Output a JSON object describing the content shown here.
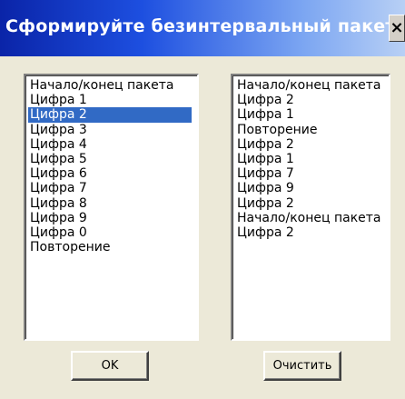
{
  "window": {
    "title": "Сформируйте безинтервальный пакет ...",
    "close_label": "×"
  },
  "left_list": {
    "items": [
      "Начало/конец пакета",
      "Цифра 1",
      "Цифра 2",
      "Цифра 3",
      "Цифра 4",
      "Цифра 5",
      "Цифра 6",
      "Цифра 7",
      "Цифра 8",
      "Цифра 9",
      "Цифра 0",
      "Повторение"
    ],
    "selected": "Цифра 2"
  },
  "right_list": {
    "items": [
      "Начало/конец пакета",
      "Цифра 2",
      "Цифра 1",
      "Повторение",
      "Цифра 2",
      "Цифра 1",
      "Цифра 7",
      "Цифра 9",
      "Цифра 2",
      "Начало/конец пакета",
      "Цифра 2"
    ]
  },
  "buttons": {
    "ok_label": "OK",
    "clear_label": "Очистить"
  }
}
